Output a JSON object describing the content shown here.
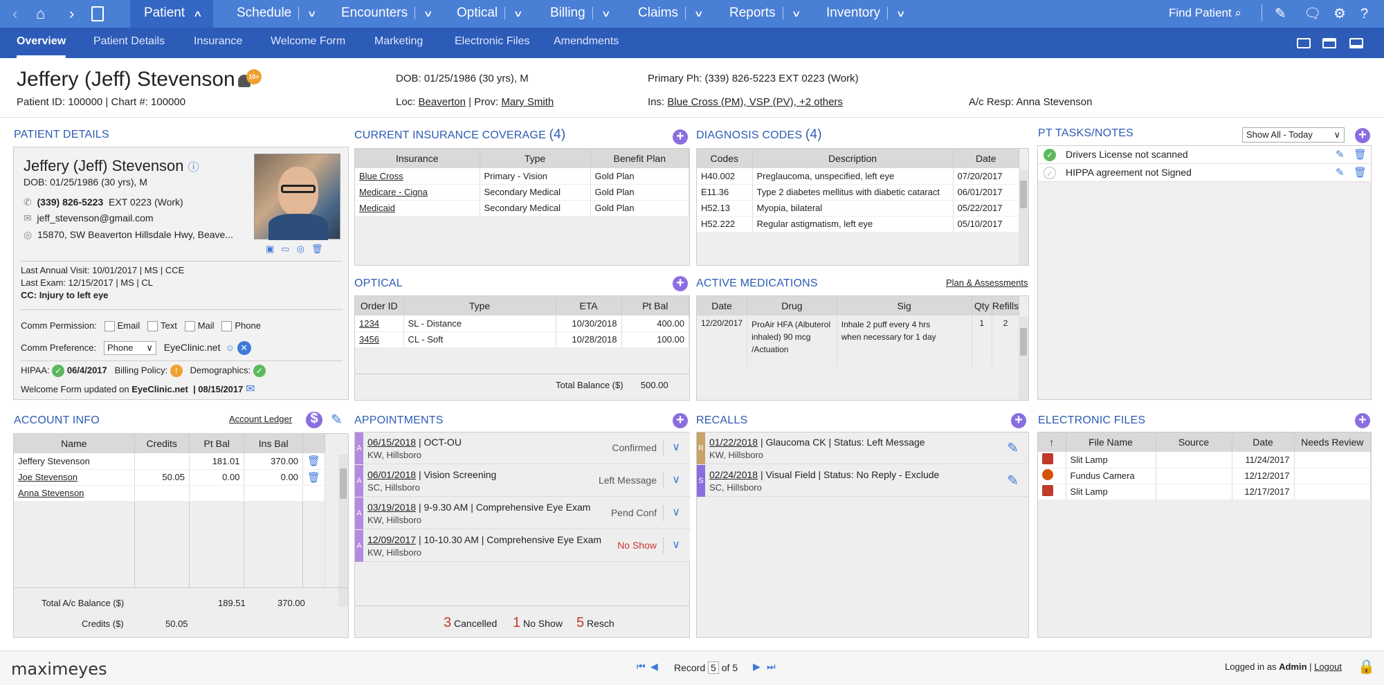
{
  "nav": {
    "items": [
      "Patient",
      "Schedule",
      "Encounters",
      "Optical",
      "Billing",
      "Claims",
      "Reports",
      "Inventory"
    ],
    "find": "Find Patient"
  },
  "subnav": [
    "Overview",
    "Patient Details",
    "Insurance",
    "Welcome Form",
    "Marketing",
    "Electronic Files",
    "Amendments"
  ],
  "header": {
    "name": "Jeffery (Jeff) Stevenson",
    "badge": "10+",
    "ids": "Patient ID: 100000 | Chart #: 100000",
    "dob": "DOB: 01/25/1986 (30 yrs), M",
    "loc_label": "Loc:",
    "loc": "Beaverton",
    "prov_label": "| Prov:",
    "prov": "Mary Smith",
    "phone": "Primary Ph: (339) 826-5223 EXT 0223 (Work)",
    "ins_label": "Ins:",
    "ins": "Blue Cross (PM), VSP (PV), +2 others",
    "acresp": "A/c Resp: Anna Stevenson"
  },
  "patient_details": {
    "title": "PATIENT DETAILS",
    "name": "Jeffery (Jeff) Stevenson",
    "dob": "DOB: 01/25/1986 (30 yrs), M",
    "phone": "(339) 826-5223",
    "phone_ext": "EXT 0223 (Work)",
    "email": "jeff_stevenson@gmail.com",
    "address": "15870, SW Beaverton Hillsdale Hwy, Beave...",
    "last_annual": "Last Annual Visit: 10/01/2017 | MS | CCE",
    "last_exam": "Last Exam: 12/15/2017 | MS | CL",
    "cc": "CC: Injury to left eye",
    "comm_permission": "Comm Permission:",
    "perm": [
      "Email",
      "Text",
      "Mail",
      "Phone"
    ],
    "comm_pref": "Comm Preference:",
    "pref_value": "Phone",
    "eyeclinic": "EyeClinic.net",
    "hipaa": "HIPAA:",
    "hipaa_date": "06/4/2017",
    "billing_policy": "Billing Policy:",
    "demographics": "Demographics:",
    "welcome": "Welcome Form updated on",
    "welcome_site": "EyeClinic.net",
    "welcome_date": "| 08/15/2017"
  },
  "insurance": {
    "title": "CURRENT INSURANCE COVERAGE",
    "count": "(4)",
    "headers": [
      "Insurance",
      "Type",
      "Benefit Plan"
    ],
    "rows": [
      [
        "Blue Cross",
        "Primary - Vision",
        "Gold Plan"
      ],
      [
        "Medicare - Cigna",
        "Secondary Medical",
        "Gold Plan"
      ],
      [
        "Medicaid",
        "Secondary Medical",
        "Gold Plan"
      ]
    ]
  },
  "diagnosis": {
    "title": "DIAGNOSIS CODES",
    "count": "(4)",
    "headers": [
      "Codes",
      "Description",
      "Date"
    ],
    "rows": [
      [
        "H40.002",
        "Preglaucoma, unspecified, left eye",
        "07/20/2017"
      ],
      [
        "E11.36",
        "Type 2 diabetes mellitus with diabetic cataract",
        "06/01/2017"
      ],
      [
        "H52.13",
        "Myopia, bilateral",
        "05/22/2017"
      ],
      [
        "H52.222",
        "Regular astigmatism, left eye",
        "05/10/2017"
      ]
    ]
  },
  "tasks": {
    "title": "PT TASKS/NOTES",
    "filter": "Show All - Today",
    "items": [
      "Drivers License not scanned",
      "HIPPA agreement not Signed"
    ]
  },
  "optical": {
    "title": "OPTICAL",
    "headers": [
      "Order ID",
      "Type",
      "ETA",
      "Pt Bal"
    ],
    "rows": [
      [
        "1234",
        "SL - Distance",
        "10/30/2018",
        "400.00"
      ],
      [
        "3456",
        "CL - Soft",
        "10/28/2018",
        "100.00"
      ]
    ],
    "total_label": "Total Balance ($)",
    "total": "500.00"
  },
  "medications": {
    "title": "ACTIVE MEDICATIONS",
    "link": "Plan & Assessments",
    "headers": [
      "Date",
      "Drug",
      "Sig",
      "Qty",
      "Refills"
    ],
    "date": "12/20/2017",
    "drug": [
      "ProAir HFA (Albuterol",
      "inhaled) 90 mcg",
      "/Actuation"
    ],
    "sig": [
      "Inhale 2 puff every  4 hrs",
      "when necessary for 1 day"
    ],
    "qty": "1",
    "refills": "2"
  },
  "account": {
    "title": "ACCOUNT INFO",
    "ledger": "Account Ledger",
    "headers": [
      "Name",
      "Credits",
      "Pt Bal",
      "Ins Bal"
    ],
    "rows": [
      [
        "Jeffery Stevenson",
        "",
        "181.01",
        "370.00"
      ],
      [
        "Joe Stevenson",
        "50.05",
        "0.00",
        "0.00"
      ],
      [
        "Anna Stevenson",
        "",
        "",
        ""
      ]
    ],
    "total_label": "Total A/c Balance ($)",
    "total_pt": "189.51",
    "total_ins": "370.00",
    "credits_label": "Credits ($)",
    "credits": "50.05"
  },
  "appointments": {
    "title": "APPOINTMENTS",
    "items": [
      {
        "tag": "A",
        "date": "06/15/2018",
        "desc": " | OCT-OU",
        "loc": "KW, Hillsboro",
        "status": "Confirmed"
      },
      {
        "tag": "A",
        "date": "06/01/2018",
        "desc": " | Vision Screening",
        "loc": "SC, Hillsboro",
        "status": "Left Message"
      },
      {
        "tag": "A",
        "date": "03/19/2018",
        "desc": " | 9-9.30 AM | Comprehensive Eye Exam",
        "loc": "KW, Hillsboro",
        "status": "Pend Conf"
      },
      {
        "tag": "A",
        "date": "12/09/2017",
        "desc": " | 10-10.30 AM | Comprehensive Eye Exam",
        "loc": "KW, Hillsboro",
        "status": "No Show"
      }
    ],
    "summary": [
      {
        "n": "3",
        "label": "Cancelled"
      },
      {
        "n": "1",
        "label": "No Show"
      },
      {
        "n": "5",
        "label": "Resch"
      }
    ]
  },
  "recalls": {
    "title": "RECALLS",
    "items": [
      {
        "tag": "R",
        "date": "01/22/2018",
        "desc": " | Glaucoma CK | Status: Left Message",
        "loc": "KW, Hillsboro",
        "color": "#c9a36a"
      },
      {
        "tag": "S",
        "date": "02/24/2018",
        "desc": " | Visual Field | Status: No Reply - Exclude",
        "loc": "SC, Hillsboro",
        "color": "#8a6ee0"
      }
    ]
  },
  "efiles": {
    "title": "ELECTRONIC FILES",
    "headers": [
      "",
      "File Name",
      "Source",
      "Date",
      "Needs Review"
    ],
    "rows": [
      [
        "Slit Lamp",
        "",
        "11/24/2017",
        ""
      ],
      [
        "Fundus Camera",
        "",
        "12/12/2017",
        ""
      ],
      [
        "Slit Lamp",
        "",
        "12/17/2017",
        ""
      ]
    ]
  },
  "footer": {
    "logo": "maximeyes",
    "record_label": "Record",
    "record": "5",
    "of": "of 5",
    "logged": "Logged in as",
    "user": "Admin",
    "sep": "|",
    "logout": "Logout"
  }
}
